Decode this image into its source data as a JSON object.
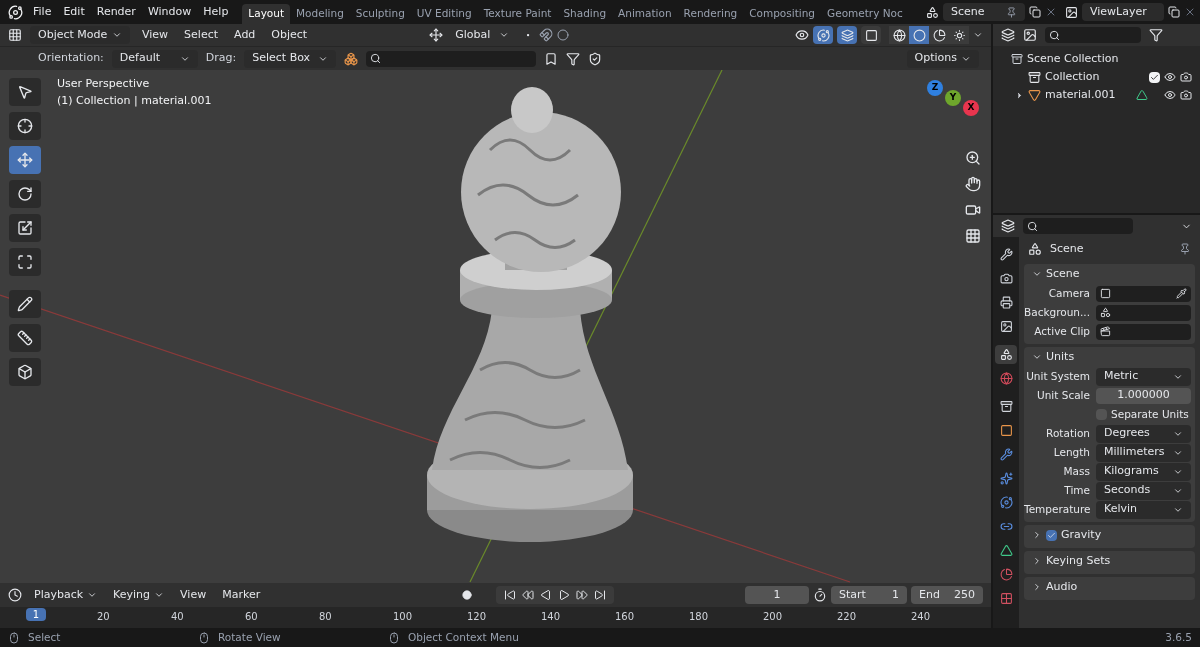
{
  "top_menu": [
    "File",
    "Edit",
    "Render",
    "Window",
    "Help"
  ],
  "workspace_tabs": [
    {
      "label": "Layout",
      "selected": true
    },
    {
      "label": "Modeling",
      "selected": false
    },
    {
      "label": "Sculpting",
      "selected": false
    },
    {
      "label": "UV Editing",
      "selected": false
    },
    {
      "label": "Texture Paint",
      "selected": false
    },
    {
      "label": "Shading",
      "selected": false
    },
    {
      "label": "Animation",
      "selected": false
    },
    {
      "label": "Rendering",
      "selected": false
    },
    {
      "label": "Compositing",
      "selected": false
    },
    {
      "label": "Geometry Noc",
      "selected": false
    }
  ],
  "scene_selector": {
    "value": "Scene"
  },
  "view_layer_selector": {
    "value": "ViewLayer"
  },
  "viewport_header": {
    "mode": "Object Mode",
    "menus": [
      "View",
      "Select",
      "Add",
      "Object"
    ],
    "transform": "Global",
    "toggles": [
      {
        "kind": "gizmo",
        "on": true
      },
      {
        "kind": "overlays",
        "on": true
      },
      {
        "kind": "xray",
        "on": false
      }
    ],
    "shading": [
      {
        "kind": "wireframe",
        "selected": false
      },
      {
        "kind": "solid",
        "selected": true
      },
      {
        "kind": "material",
        "selected": false
      },
      {
        "kind": "rendered",
        "selected": false
      }
    ]
  },
  "tool_settings": {
    "orientation_label": "Orientation:",
    "orientation": "Default",
    "drag_label": "Drag:",
    "drag": "Select Box",
    "options": "Options"
  },
  "viewport": {
    "title": "User Perspective",
    "subtitle": "(1) Collection | material.001",
    "gizmo": [
      {
        "label": "Z",
        "color": "#2f80e0"
      },
      {
        "label": "Y",
        "color": "#6ea62c"
      },
      {
        "label": "X",
        "color": "#e8354e"
      }
    ]
  },
  "tools": [
    {
      "kind": "select",
      "selected": false
    },
    {
      "kind": "cursor",
      "selected": false
    },
    {
      "kind": "move",
      "selected": true
    },
    {
      "kind": "rotate",
      "selected": false
    },
    {
      "kind": "scale",
      "selected": false
    },
    {
      "kind": "transform",
      "selected": false
    },
    {
      "kind": "annotate",
      "selected": false
    },
    {
      "kind": "measure",
      "selected": false
    },
    {
      "kind": "add_cube",
      "selected": false
    }
  ],
  "outliner": {
    "items": [
      {
        "label": "Scene Collection",
        "kind": "scene",
        "children": [
          {
            "label": "Collection",
            "kind": "collection",
            "checked": true
          },
          {
            "label": "material.001",
            "kind": "object",
            "expanded": false
          }
        ]
      }
    ]
  },
  "properties": {
    "context": "Scene",
    "tabs": [
      {
        "kind": "tool",
        "selected": false
      },
      {
        "kind": "render",
        "selected": false
      },
      {
        "kind": "output",
        "selected": false
      },
      {
        "kind": "view_layer",
        "selected": false
      },
      {
        "kind": "scene",
        "selected": true
      },
      {
        "kind": "world",
        "selected": false
      },
      {
        "kind": "collection",
        "selected": false
      },
      {
        "kind": "object",
        "selected": false
      },
      {
        "kind": "modifiers",
        "selected": false
      },
      {
        "kind": "particles",
        "selected": false
      },
      {
        "kind": "physics",
        "selected": false
      },
      {
        "kind": "constraints",
        "selected": false
      },
      {
        "kind": "data",
        "selected": false
      },
      {
        "kind": "material",
        "selected": false
      },
      {
        "kind": "texture",
        "selected": false
      }
    ],
    "panels": [
      {
        "title": "Scene",
        "expanded": true,
        "rows": [
          {
            "kind": "object",
            "label": "Camera"
          },
          {
            "kind": "object",
            "label": "Backgroun..."
          },
          {
            "kind": "object",
            "label": "Active Clip"
          }
        ]
      },
      {
        "title": "Units",
        "expanded": true,
        "rows": [
          {
            "kind": "dropdown",
            "label": "Unit System",
            "value": "Metric"
          },
          {
            "kind": "number",
            "label": "Unit Scale",
            "value": "1.000000"
          },
          {
            "kind": "checkbox",
            "label": "Separate Units",
            "checked": false
          },
          {
            "kind": "dropdown",
            "label": "Rotation",
            "value": "Degrees"
          },
          {
            "kind": "dropdown",
            "label": "Length",
            "value": "Millimeters"
          },
          {
            "kind": "dropdown",
            "label": "Mass",
            "value": "Kilograms"
          },
          {
            "kind": "dropdown",
            "label": "Time",
            "value": "Seconds"
          },
          {
            "kind": "dropdown",
            "label": "Temperature",
            "value": "Kelvin"
          }
        ]
      },
      {
        "title": "Gravity",
        "expanded": false,
        "checked": true
      },
      {
        "title": "Keying Sets",
        "expanded": false
      },
      {
        "title": "Audio",
        "expanded": false
      }
    ]
  },
  "timeline": {
    "menus": [
      "Playback",
      "Keying",
      "View",
      "Marker"
    ],
    "current_frame": "1",
    "start_label": "Start",
    "start": "1",
    "end_label": "End",
    "end": "250",
    "playhead": "1",
    "ticks": [
      "20",
      "40",
      "60",
      "80",
      "100",
      "120",
      "140",
      "160",
      "180",
      "200",
      "220",
      "240"
    ]
  },
  "status_bar": {
    "items": [
      "Select",
      "Rotate View",
      "Object Context Menu"
    ],
    "version": "3.6.5"
  }
}
